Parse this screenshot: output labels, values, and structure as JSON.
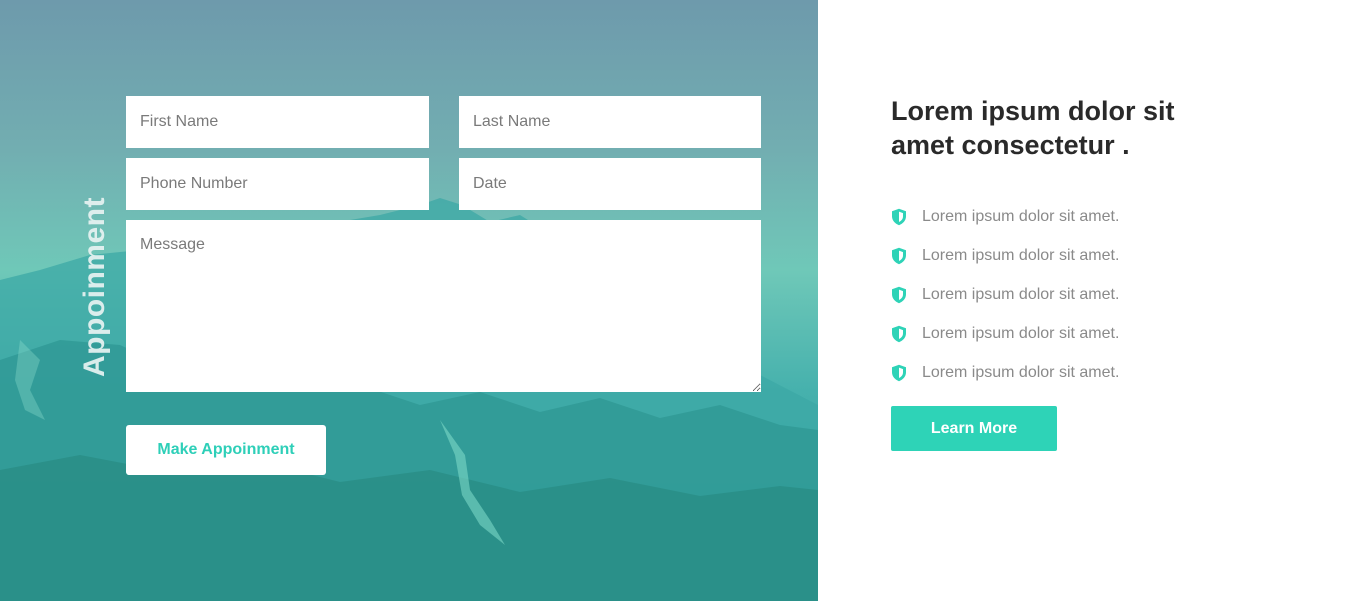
{
  "colors": {
    "accent": "#2ed3b7",
    "title_text": "#2a2a2a",
    "muted_text": "#8a8a8a"
  },
  "appointment": {
    "vertical_title": "Appoinment",
    "first_name_placeholder": "First Name",
    "last_name_placeholder": "Last Name",
    "phone_placeholder": "Phone Number",
    "date_placeholder": "Date",
    "message_placeholder": "Message",
    "submit_label": "Make Appoinment"
  },
  "info": {
    "title": "Lorem ipsum dolor sit amet consectetur .",
    "features": [
      {
        "icon": "shield-icon",
        "text": "Lorem ipsum dolor sit amet."
      },
      {
        "icon": "shield-icon",
        "text": "Lorem ipsum dolor sit amet."
      },
      {
        "icon": "shield-icon",
        "text": "Lorem ipsum dolor sit amet."
      },
      {
        "icon": "shield-icon",
        "text": "Lorem ipsum dolor sit amet."
      },
      {
        "icon": "shield-icon",
        "text": "Lorem ipsum dolor sit amet."
      }
    ],
    "cta_label": "Learn More"
  }
}
